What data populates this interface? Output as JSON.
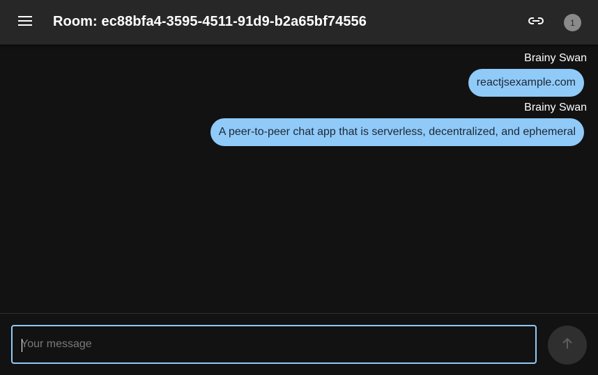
{
  "header": {
    "title": "Room: ec88bfa4-3595-4511-91d9-b2a65bf74556",
    "menu_icon": "menu-icon",
    "link_icon": "link-icon",
    "peer_count": "1"
  },
  "messages": [
    {
      "author": "Brainy Swan",
      "text": "reactjsexample.com"
    },
    {
      "author": "Brainy Swan",
      "text": "A peer-to-peer chat app that is serverless, decentralized, and ephemeral"
    }
  ],
  "composer": {
    "placeholder": "Your message",
    "value": "",
    "send_icon": "arrow-up-icon"
  },
  "colors": {
    "appbar": "#272727",
    "background": "#121212",
    "bubble": "#90caf9",
    "input_border": "#90caf9"
  }
}
